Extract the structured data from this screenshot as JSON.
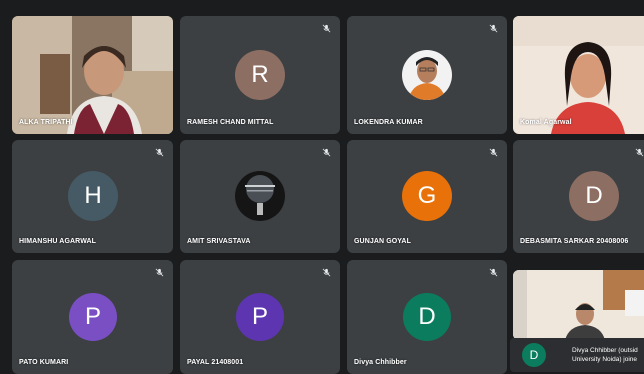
{
  "participants": [
    {
      "name": "ALKA TRIPATHI"
    },
    {
      "name": "RAMESH CHAND MITTAL",
      "initial": "R",
      "color": "#8d6e63"
    },
    {
      "name": "LOKENDRA KUMAR"
    },
    {
      "name": "Komal Agarwal"
    },
    {
      "name": "HIMANSHU AGARWAL",
      "initial": "H",
      "color": "#455a64"
    },
    {
      "name": "AMIT SRIVASTAVA"
    },
    {
      "name": "GUNJAN GOYAL",
      "initial": "G",
      "color": "#e8710a"
    },
    {
      "name": "DEBASMITA SARKAR 20408006",
      "initial": "D",
      "color": "#8d6e63"
    },
    {
      "name": "PATO KUMARI",
      "initial": "P",
      "color": "#7b4fc4"
    },
    {
      "name": "PAYAL 21408001",
      "initial": "P",
      "color": "#5e35b1"
    },
    {
      "name": "Divya Chhibber",
      "initial": "D",
      "color": "#0b7d5e"
    }
  ],
  "notification": {
    "initial": "D",
    "line1": "Divya Chhibber (outsid",
    "line2": "University Noida) joine"
  },
  "icons": {
    "mic_off": "mic-off-icon"
  }
}
